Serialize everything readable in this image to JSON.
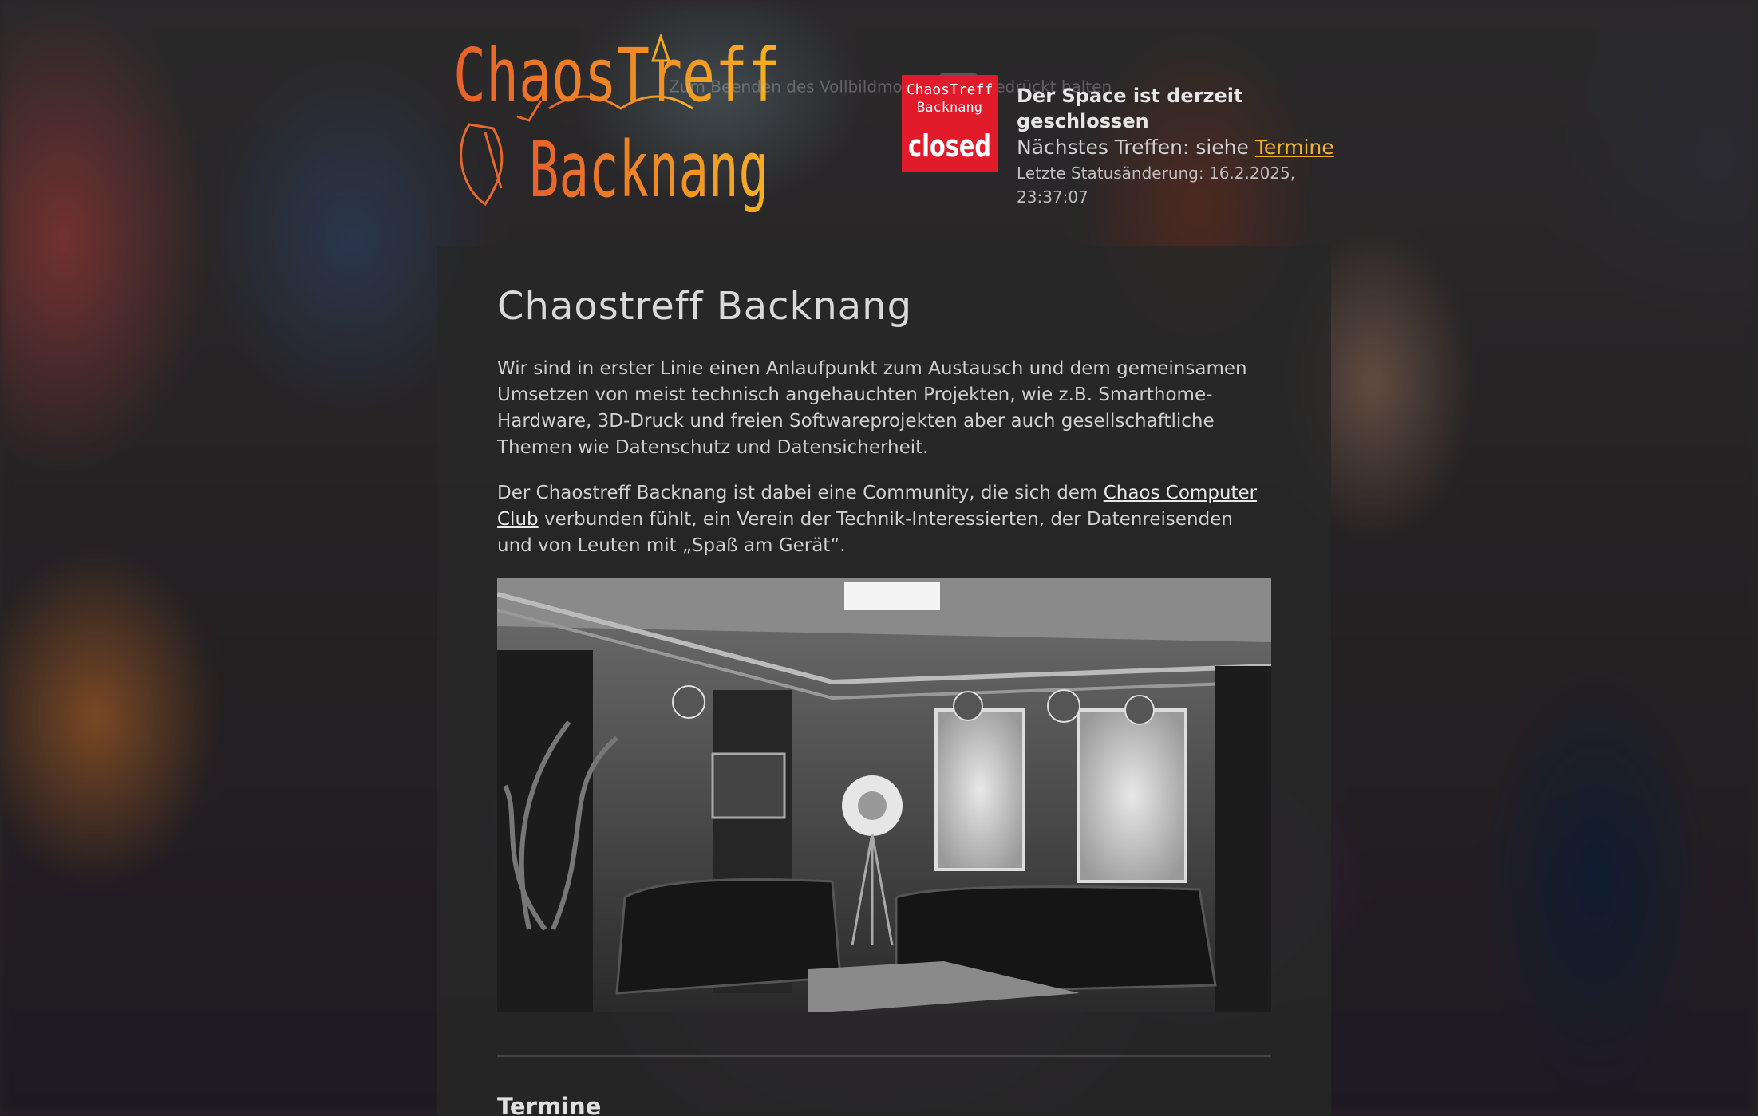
{
  "header": {
    "logo_line1": "ChaosTreff",
    "logo_line2": "Backnang",
    "hint_text_left": "Zum Beenden des Vollbildmodus",
    "hint_text_right": "gedrückt halten"
  },
  "status": {
    "badge_line1": "ChaosTreff",
    "badge_line2": "Backnang",
    "badge_state": "closed",
    "title": "Der Space ist derzeit geschlossen",
    "next_prefix": "Nächstes Treffen: siehe ",
    "next_link": "Termine",
    "last_change": "Letzte Statusänderung: 16.2.2025, 23:37:07"
  },
  "main": {
    "title": "Chaostreff Backnang",
    "paragraph1": "Wir sind in erster Linie einen Anlaufpunkt zum Austausch und dem gemeinsamen Umsetzen von meist technisch angehauchten Projekten, wie z.B. Smarthome-Hardware, 3D-Druck und freien Softwareprojekten aber auch gesellschaftliche Themen wie Datenschutz und Datensicherheit.",
    "paragraph2_prefix": "Der Chaostreff Backnang ist dabei eine Community, die sich dem ",
    "paragraph2_link": "Chaos Computer Club",
    "paragraph2_suffix": " verbunden fühlt, ein Verein der Technik-Interessierten, der Datenreisenden und von Leuten mit „Spaß am Gerät“.",
    "section_title": "Termine"
  },
  "colors": {
    "accent": "#f0b428",
    "logo_orange": "#e8682a",
    "logo_yellow": "#f2a922",
    "badge_red": "#e21b2a"
  }
}
